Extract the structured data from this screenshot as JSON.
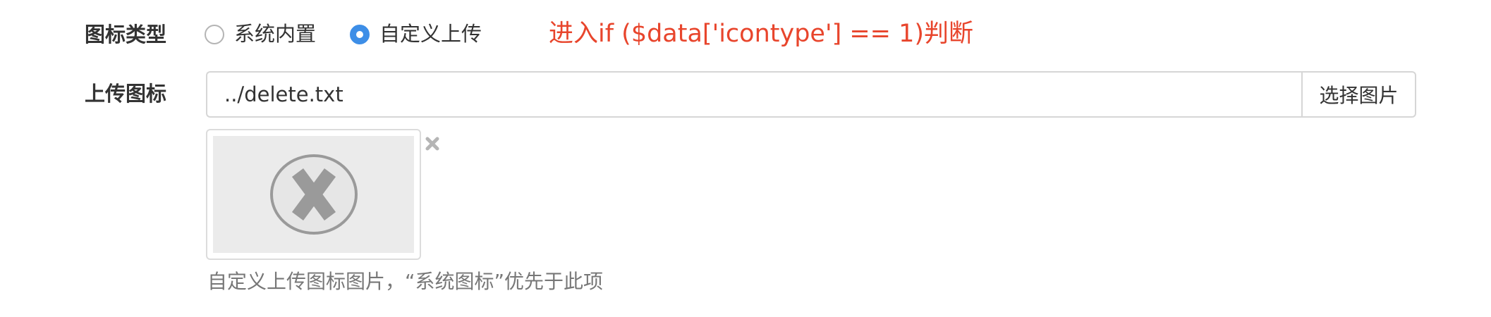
{
  "icon_type": {
    "label": "图标类型",
    "options": [
      {
        "label": "系统内置",
        "checked": false
      },
      {
        "label": "自定义上传",
        "checked": true
      }
    ]
  },
  "annotation": "进入if ($data['icontype'] == 1)判断",
  "upload": {
    "label": "上传图标",
    "value": "../delete.txt",
    "button_label": "选择图片",
    "preview_icon": "broken-image-x-icon",
    "remove_icon": "close-icon"
  },
  "help_text": "自定义上传图标图片，“系统图标”优先于此项",
  "colors": {
    "accent": "#3d8ee7",
    "annotation": "#e8452c",
    "border": "#d6d6d6",
    "help": "#777777"
  }
}
